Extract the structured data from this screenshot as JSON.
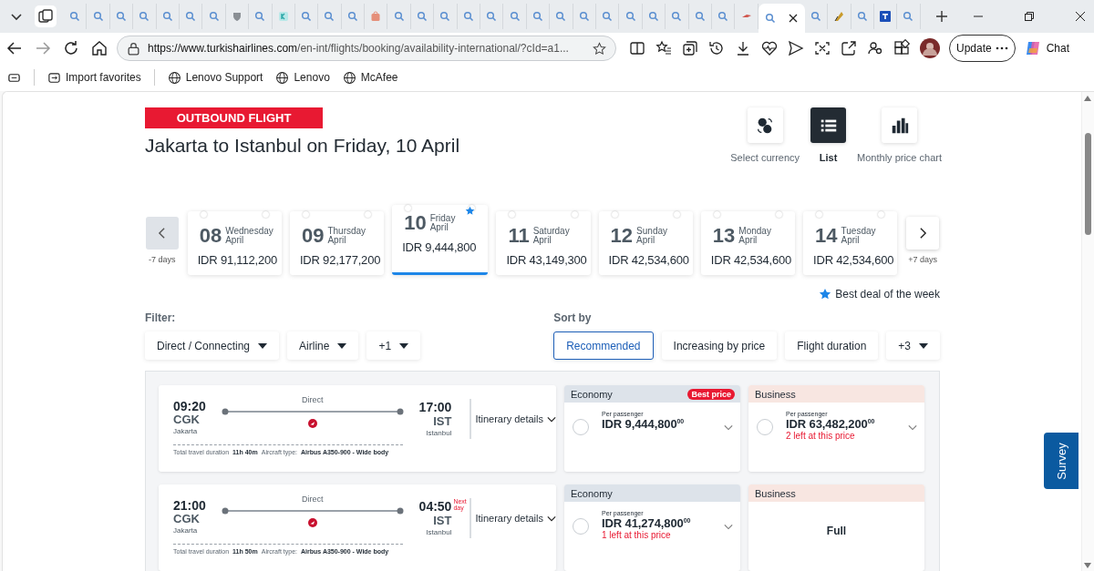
{
  "browser": {
    "tabs": [
      {
        "kind": "search",
        "selected": false
      },
      {
        "kind": "search",
        "selected": false
      },
      {
        "kind": "search",
        "selected": false
      },
      {
        "kind": "search",
        "selected": false
      },
      {
        "kind": "search",
        "selected": false
      },
      {
        "kind": "search",
        "selected": false
      },
      {
        "kind": "search",
        "selected": false
      },
      {
        "kind": "shield",
        "selected": false
      },
      {
        "kind": "search",
        "selected": false
      },
      {
        "kind": "tile",
        "selected": false
      },
      {
        "kind": "search",
        "selected": false
      },
      {
        "kind": "search",
        "selected": false
      },
      {
        "kind": "search",
        "selected": false
      },
      {
        "kind": "bag",
        "selected": false
      },
      {
        "kind": "search",
        "selected": false
      },
      {
        "kind": "search",
        "selected": false
      },
      {
        "kind": "search",
        "selected": false
      },
      {
        "kind": "search",
        "selected": false
      },
      {
        "kind": "search",
        "selected": false
      },
      {
        "kind": "search",
        "selected": false
      },
      {
        "kind": "search",
        "selected": false
      },
      {
        "kind": "search",
        "selected": false
      },
      {
        "kind": "search",
        "selected": false
      },
      {
        "kind": "search",
        "selected": false
      },
      {
        "kind": "search",
        "selected": false
      },
      {
        "kind": "search",
        "selected": false
      },
      {
        "kind": "search",
        "selected": false
      },
      {
        "kind": "search",
        "selected": false
      },
      {
        "kind": "search",
        "selected": false
      },
      {
        "kind": "bird",
        "selected": false
      },
      {
        "kind": "search",
        "selected": true
      },
      {
        "kind": "search",
        "selected": false
      },
      {
        "kind": "feather",
        "selected": false
      },
      {
        "kind": "search",
        "selected": false
      },
      {
        "kind": "square",
        "selected": false
      },
      {
        "kind": "search",
        "selected": false
      }
    ],
    "url": {
      "host": "https://www.turkishairlines.com",
      "path": "/en-int/flights/booking/availability-international/?cId=a1..."
    },
    "update_button": "Update",
    "chat_button": "Chat",
    "bookmarks": [
      {
        "label": "Import favorites",
        "kind": "import"
      },
      {
        "label": "Lenovo Support",
        "kind": "globe"
      },
      {
        "label": "Lenovo",
        "kind": "globe"
      },
      {
        "label": "McAfee",
        "kind": "globe"
      }
    ]
  },
  "page": {
    "badge": "OUTBOUND FLIGHT",
    "title": "Jakarta to Istanbul on Friday, 10 April",
    "view_options": [
      {
        "label": "Select currency",
        "kind": "currency",
        "selected": false
      },
      {
        "label": "List",
        "kind": "list",
        "selected": true
      },
      {
        "label": "Monthly price chart",
        "kind": "chart",
        "selected": false
      }
    ],
    "dates": {
      "prev_label": "-7 days",
      "next_label": "+7 days",
      "items": [
        {
          "day": "08",
          "weekday": "Wednesday",
          "month": "April",
          "price": "IDR 91,112,200",
          "selected": false,
          "best": false
        },
        {
          "day": "09",
          "weekday": "Thursday",
          "month": "April",
          "price": "IDR 92,177,200",
          "selected": false,
          "best": false
        },
        {
          "day": "10",
          "weekday": "Friday",
          "month": "April",
          "price": "IDR 9,444,800",
          "selected": true,
          "best": true
        },
        {
          "day": "11",
          "weekday": "Saturday",
          "month": "April",
          "price": "IDR 43,149,300",
          "selected": false,
          "best": false
        },
        {
          "day": "12",
          "weekday": "Sunday",
          "month": "April",
          "price": "IDR 42,534,600",
          "selected": false,
          "best": false
        },
        {
          "day": "13",
          "weekday": "Monday",
          "month": "April",
          "price": "IDR 42,534,600",
          "selected": false,
          "best": false
        },
        {
          "day": "14",
          "weekday": "Tuesday",
          "month": "April",
          "price": "IDR 42,534,600",
          "selected": false,
          "best": false
        }
      ]
    },
    "best_deal": "Best deal of the week",
    "filter": {
      "label": "Filter:",
      "options": [
        "Direct / Connecting",
        "Airline",
        "+1"
      ]
    },
    "sort": {
      "label": "Sort by",
      "options": [
        {
          "label": "Recommended",
          "selected": true,
          "dropdown": false
        },
        {
          "label": "Increasing by price",
          "selected": false,
          "dropdown": false
        },
        {
          "label": "Flight duration",
          "selected": false,
          "dropdown": false
        },
        {
          "label": "+3",
          "selected": false,
          "dropdown": true
        }
      ]
    },
    "flights": [
      {
        "dep_time": "09:20",
        "dep_code": "CGK",
        "dep_city": "Jakarta",
        "stops": "Direct",
        "arr_time": "17:00",
        "arr_code": "IST",
        "arr_city": "Istanbul",
        "duration_label": "Total travel duration",
        "duration": "11h 40m",
        "aircraft_label": "Aircraft type:",
        "aircraft": "Airbus A350-900 - Wide body",
        "details": "Itinerary details",
        "fares": [
          {
            "cabin": "Economy",
            "kind": "economy",
            "badge": "Best price",
            "per": "Per passenger",
            "price": "IDR 9,444,800$^{00}$",
            "selected": false
          },
          {
            "cabin": "Business",
            "kind": "business",
            "per": "Per passenger",
            "price": "IDR 63,482,200$^{00}$",
            "selected": false,
            "seats": "2 left at this price"
          }
        ]
      },
      {
        "dep_time": "21:00",
        "dep_code": "CGK",
        "dep_city": "Jakarta",
        "stops": "Direct",
        "arr_time": "04:50",
        "next_day": "Next day",
        "arr_code": "IST",
        "arr_city": "Istanbul",
        "duration_label": "Total travel duration",
        "duration": "11h 50m",
        "aircraft_label": "Aircraft type:",
        "aircraft": "Airbus A350-900 - Wide body",
        "details": "Itinerary details",
        "fares": [
          {
            "cabin": "Economy",
            "kind": "economy",
            "per": "Per passenger",
            "price": "IDR 41,274,800$^{00}$",
            "selected": false,
            "seats": "1 left at this price"
          },
          {
            "cabin": "Business",
            "kind": "business",
            "status": "Full"
          }
        ]
      }
    ]
  },
  "survey": "Survey"
}
